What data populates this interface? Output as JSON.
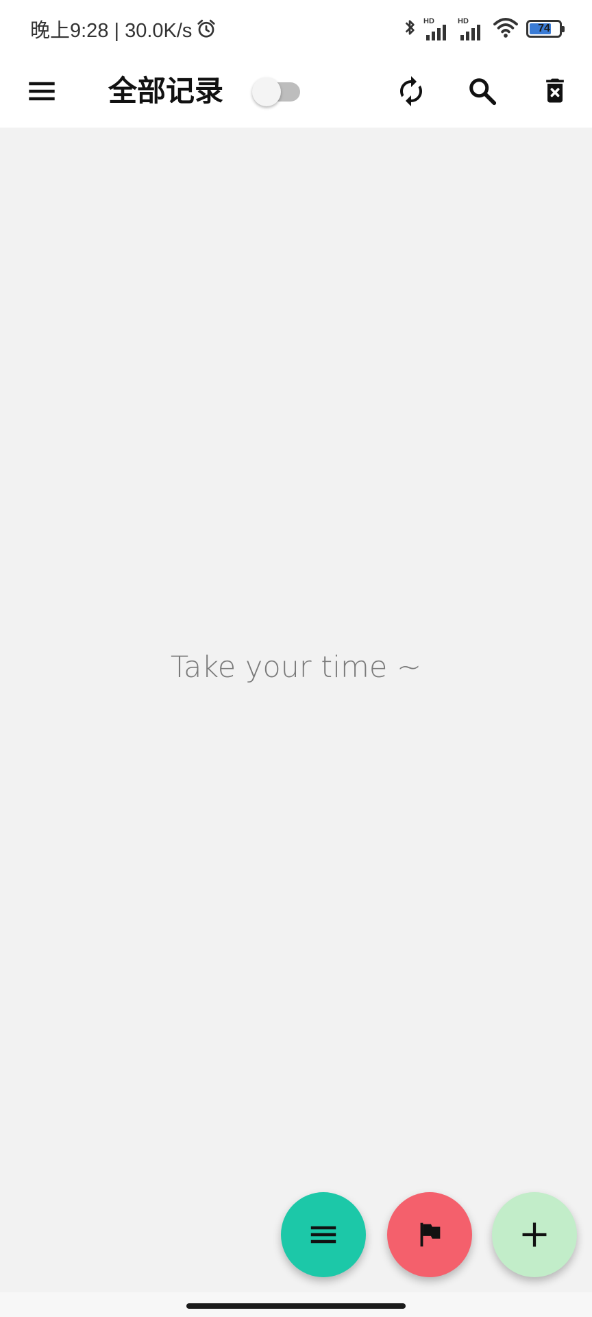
{
  "status_bar": {
    "time_text": "晚上9:28 | 30.0K/s",
    "battery_level": "74",
    "battery_fraction": 0.74,
    "icons": [
      "alarm-icon",
      "bluetooth-icon",
      "signal-hd-icon",
      "signal-hd-icon",
      "wifi-icon",
      "battery-icon"
    ]
  },
  "app_bar": {
    "title": "全部记录",
    "toggle_on": false,
    "icons": [
      "menu-icon",
      "refresh-icon",
      "search-icon",
      "delete-icon"
    ]
  },
  "content": {
    "empty_message": "Take your time ~"
  },
  "fabs": [
    {
      "name": "list-fab",
      "icon": "list-icon",
      "color": "#1cc8a8"
    },
    {
      "name": "flag-fab",
      "icon": "flag-icon",
      "color": "#f4606c"
    },
    {
      "name": "add-fab",
      "icon": "plus-icon",
      "color": "#c2edc9"
    }
  ],
  "colors": {
    "background": "#f2f2f2",
    "app_bar": "#ffffff",
    "battery_fill": "#3a7bd5"
  }
}
